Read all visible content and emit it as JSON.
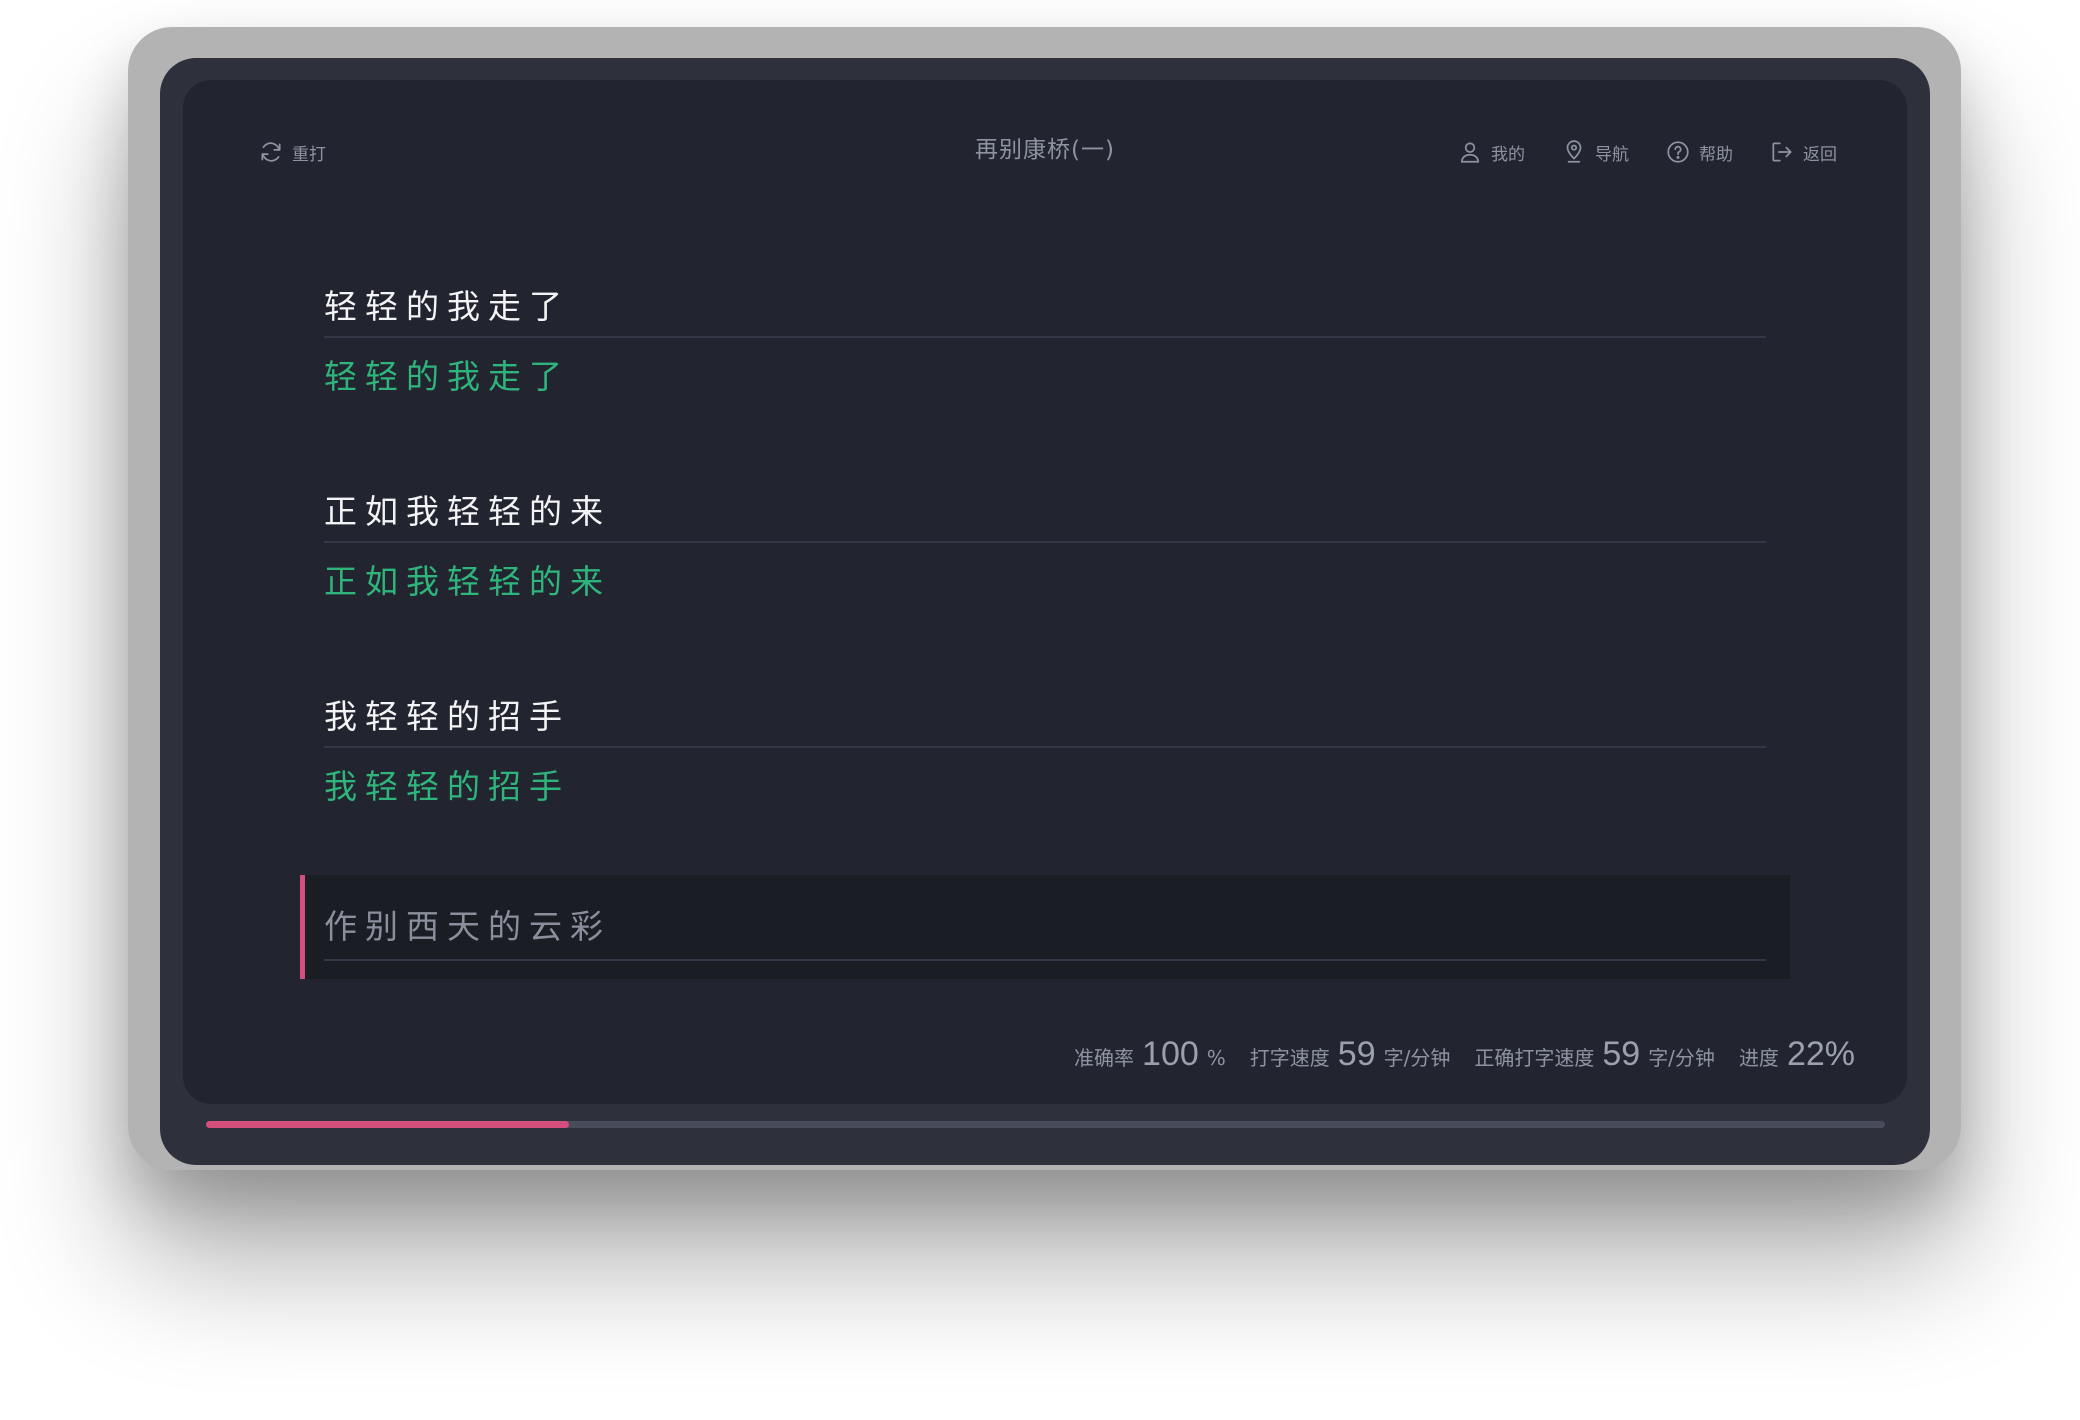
{
  "header": {
    "title": "再别康桥(一)",
    "restart": {
      "label": "重打",
      "icon": "refresh-icon"
    },
    "nav": [
      {
        "key": "profile",
        "label": "我的",
        "icon": "user-icon"
      },
      {
        "key": "navigation",
        "label": "导航",
        "icon": "location-pin-icon"
      },
      {
        "key": "help",
        "label": "帮助",
        "icon": "help-icon"
      },
      {
        "key": "back",
        "label": "返回",
        "icon": "exit-icon"
      }
    ]
  },
  "lines": [
    {
      "source": "轻轻的我走了",
      "typed": "轻轻的我走了"
    },
    {
      "source": "正如我轻轻的来",
      "typed": "正如我轻轻的来"
    },
    {
      "source": "我轻轻的招手",
      "typed": "我轻轻的招手"
    }
  ],
  "active_line": {
    "source": "作别西天的云彩"
  },
  "stats": {
    "accuracy": {
      "label": "准确率",
      "value": "100",
      "unit": "%"
    },
    "speed": {
      "label": "打字速度",
      "value": "59",
      "unit": "字/分钟"
    },
    "correct_speed": {
      "label": "正确打字速度",
      "value": "59",
      "unit": "字/分钟"
    },
    "progress": {
      "label": "进度",
      "value": "22%"
    }
  },
  "progress_fraction": 0.216,
  "colors": {
    "accent": "#d54f7e",
    "typed_correct": "#2fb57c",
    "screen_bg": "#22252f"
  }
}
